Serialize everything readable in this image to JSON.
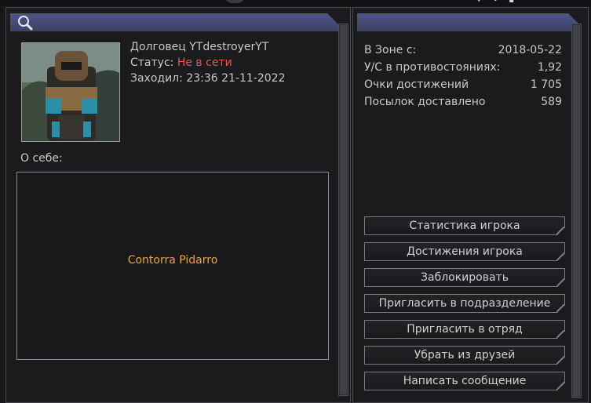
{
  "profile": {
    "name_line": "Долговец YTdestroyerYT",
    "status_label": "Статус:",
    "status_value": "Не в сети",
    "last_seen_label": "Заходил:",
    "last_seen_value": "23:36 21-11-2022",
    "about_label": "О себе:",
    "about_text": "Contorra Pidarro"
  },
  "stats": [
    {
      "label": "В Зоне с:",
      "value": "2018-05-22"
    },
    {
      "label": "У/С в противостояниях:",
      "value": "1,92"
    },
    {
      "label": "Очки достижений",
      "value": "1 705"
    },
    {
      "label": "Посылок доставлено",
      "value": "589"
    }
  ],
  "actions": [
    "Статистика игрока",
    "Достижения игрока",
    "Заблокировать",
    "Пригласить в подразделение",
    "Пригласить в отряд",
    "Убрать из друзей",
    "Написать сообщение"
  ],
  "colors": {
    "header": "#4a5080",
    "offline": "#e8544f",
    "about_text": "#f0a43a"
  },
  "icons": {
    "header_left": "search-icon"
  }
}
